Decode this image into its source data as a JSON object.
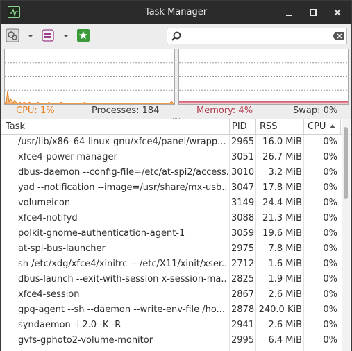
{
  "window": {
    "title": "Task Manager"
  },
  "icons": {
    "app": "task-manager-app-icon",
    "minimize": "minimize-icon",
    "maximize": "maximize-icon",
    "close": "close-icon",
    "settings": "settings-gear-icon",
    "view": "view-columns-icon",
    "quick_launch": "star-icon",
    "search": "search-magnifier-icon",
    "clear": "clear-backspace-icon"
  },
  "search": {
    "value": "",
    "placeholder": ""
  },
  "status": {
    "cpu": "CPU: 1%",
    "processes": "Processes: 184",
    "memory": "Memory: 4%",
    "swap": "Swap: 0%"
  },
  "graph": {
    "cpu_color": "#e8801e",
    "mem_color": "#d14f6a",
    "cpu_percent": 1,
    "mem_percent": 4
  },
  "columns": {
    "task": "Task",
    "pid": "PID",
    "rss": "RSS",
    "cpu": "CPU"
  },
  "rows": [
    {
      "task": "/usr/lib/x86_64-linux-gnu/xfce4/panel/wrapp...",
      "pid": "2965",
      "rss": "16.0 MiB",
      "cpu": "0%"
    },
    {
      "task": "xfce4-power-manager",
      "pid": "3051",
      "rss": "26.7 MiB",
      "cpu": "0%"
    },
    {
      "task": "dbus-daemon --config-file=/etc/at-spi2/access...",
      "pid": "3010",
      "rss": "3.2 MiB",
      "cpu": "0%"
    },
    {
      "task": "yad --notification --image=/usr/share/mx-usb...",
      "pid": "3047",
      "rss": "17.8 MiB",
      "cpu": "0%"
    },
    {
      "task": "volumeicon",
      "pid": "3149",
      "rss": "24.4 MiB",
      "cpu": "0%"
    },
    {
      "task": "xfce4-notifyd",
      "pid": "3088",
      "rss": "21.3 MiB",
      "cpu": "0%"
    },
    {
      "task": "polkit-gnome-authentication-agent-1",
      "pid": "3059",
      "rss": "19.6 MiB",
      "cpu": "0%"
    },
    {
      "task": "at-spi-bus-launcher",
      "pid": "2975",
      "rss": "7.8 MiB",
      "cpu": "0%"
    },
    {
      "task": "sh /etc/xdg/xfce4/xinitrc -- /etc/X11/xinit/xser...",
      "pid": "2712",
      "rss": "1.6 MiB",
      "cpu": "0%"
    },
    {
      "task": "dbus-launch --exit-with-session x-session-ma...",
      "pid": "2825",
      "rss": "1.9 MiB",
      "cpu": "0%"
    },
    {
      "task": "xfce4-session",
      "pid": "2867",
      "rss": "2.6 MiB",
      "cpu": "0%"
    },
    {
      "task": "gpg-agent --sh --daemon --write-env-file /ho...",
      "pid": "2878",
      "rss": "240.0 KiB",
      "cpu": "0%"
    },
    {
      "task": "syndaemon -i 2.0 -K -R",
      "pid": "2941",
      "rss": "2.6 MiB",
      "cpu": "0%"
    },
    {
      "task": "gvfs-gphoto2-volume-monitor",
      "pid": "2995",
      "rss": "6.4 MiB",
      "cpu": "0%"
    }
  ]
}
